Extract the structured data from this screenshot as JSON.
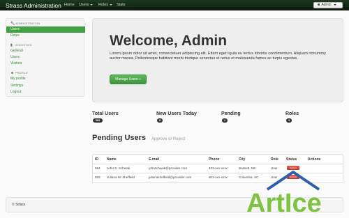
{
  "navbar": {
    "brand": "Strass Administration",
    "items": [
      {
        "label": "Home",
        "dropdown": false
      },
      {
        "label": "Users",
        "dropdown": true
      },
      {
        "label": "Roles",
        "dropdown": true
      },
      {
        "label": "Stats",
        "dropdown": false
      }
    ],
    "user_button": "Admin"
  },
  "sidebar": {
    "sections": [
      {
        "header": "Administration",
        "icon": "wrench-icon",
        "items": [
          {
            "label": "Users",
            "active": true
          },
          {
            "label": "Roles",
            "active": false
          }
        ]
      },
      {
        "header": "Statistics",
        "icon": "signal-icon",
        "items": [
          {
            "label": "General",
            "active": false
          },
          {
            "label": "Users",
            "active": false
          },
          {
            "label": "Visitors",
            "active": false
          }
        ]
      },
      {
        "header": "Profile",
        "icon": "user-icon",
        "items": [
          {
            "label": "My profile",
            "active": false
          },
          {
            "label": "Settings",
            "active": false
          },
          {
            "label": "Logout",
            "active": false
          }
        ]
      }
    ]
  },
  "hero": {
    "title": "Welcome, Admin",
    "text": "Lorem ipsum dolor sit amet, consectetuer adipiscing elit. Etiam eget ligula eu lectus lobortis condimentum. Aliquam nonummy auctor massa. Pellentesque habitant morbi tristique senectus et netus et malesuada fames ac turpis egestas.",
    "button": "Manage Users »"
  },
  "stats": [
    {
      "label": "Total Users",
      "value": "563"
    },
    {
      "label": "New Users Today",
      "value": "8"
    },
    {
      "label": "Pending",
      "value": "2"
    },
    {
      "label": "Roles",
      "value": "3"
    }
  ],
  "pending": {
    "title": "Pending Users",
    "subtitle": "Approve or Reject",
    "columns": [
      "ID",
      "Name",
      "E-mail",
      "Phone",
      "City",
      "Role",
      "Status",
      "Actions"
    ],
    "rows": [
      {
        "id": "564",
        "name": "John S. Schwab",
        "email": "johnschwab@provider.com",
        "phone": "402-xxx-xxxx",
        "city": "Bassett, NE",
        "role": "User",
        "status": "Inactive"
      },
      {
        "id": "565",
        "name": "Juliana M. Sheffield",
        "email": "julianasheffield@provider.com",
        "phone": "803-xxx-xxxx",
        "city": "Columbia, SC",
        "role": "User",
        "status": "Inactive"
      }
    ]
  },
  "footer": "© Strass",
  "watermark": "ArtIce",
  "colors": {
    "brand_green": "#42a042",
    "navbar_dark": "#0c1e0c",
    "danger": "#bd362f",
    "watermark_green": "#7ec242",
    "watermark_blue": "#2f5fa8"
  }
}
